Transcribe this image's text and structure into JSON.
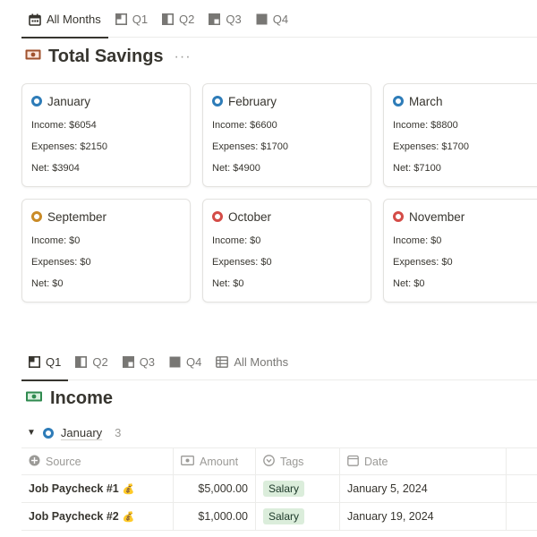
{
  "top_tabs": [
    {
      "label": "All Months",
      "icon": "calendar-icon",
      "active": true
    },
    {
      "label": "Q1",
      "icon": "quarter-icon",
      "active": false
    },
    {
      "label": "Q2",
      "icon": "half-icon",
      "active": false
    },
    {
      "label": "Q3",
      "icon": "three-quarter-icon",
      "active": false
    },
    {
      "label": "Q4",
      "icon": "full-square-icon",
      "active": false
    }
  ],
  "savings": {
    "title": "Total Savings",
    "more": "···",
    "cards": [
      {
        "month": "January",
        "dot_color": "#2e7cb8",
        "income": "Income: $6054",
        "expenses": "Expenses: $2150",
        "net": "Net: $3904"
      },
      {
        "month": "February",
        "dot_color": "#2e7cb8",
        "income": "Income: $6600",
        "expenses": "Expenses: $1700",
        "net": "Net: $4900"
      },
      {
        "month": "March",
        "dot_color": "#2e7cb8",
        "income": "Income: $8800",
        "expenses": "Expenses: $1700",
        "net": "Net: $7100"
      },
      {
        "month": "September",
        "dot_color": "#c98b27",
        "income": "Income: $0",
        "expenses": "Expenses: $0",
        "net": "Net: $0"
      },
      {
        "month": "October",
        "dot_color": "#d44c47",
        "income": "Income: $0",
        "expenses": "Expenses: $0",
        "net": "Net: $0"
      },
      {
        "month": "November",
        "dot_color": "#d44c47",
        "income": "Income: $0",
        "expenses": "Expenses: $0",
        "net": "Net: $0"
      }
    ]
  },
  "bottom_tabs": [
    {
      "label": "Q1",
      "icon": "quarter-icon",
      "active": true
    },
    {
      "label": "Q2",
      "icon": "half-icon",
      "active": false
    },
    {
      "label": "Q3",
      "icon": "three-quarter-icon",
      "active": false
    },
    {
      "label": "Q4",
      "icon": "full-square-icon",
      "active": false
    },
    {
      "label": "All Months",
      "icon": "table-icon",
      "active": false
    }
  ],
  "income": {
    "title": "Income",
    "group": {
      "label": "January",
      "count": "3",
      "dot_color": "#2e7cb8"
    },
    "columns": [
      {
        "label": "Source",
        "icon": "plus-circle-icon"
      },
      {
        "label": "Amount",
        "icon": "money-icon"
      },
      {
        "label": "Tags",
        "icon": "tags-icon"
      },
      {
        "label": "Date",
        "icon": "date-icon"
      }
    ],
    "rows": [
      {
        "source": "Job Paycheck #1",
        "emoji": "💰",
        "amount": "$5,000.00",
        "tag": "Salary",
        "date": "January 5, 2024"
      },
      {
        "source": "Job Paycheck #2",
        "emoji": "💰",
        "amount": "$1,000.00",
        "tag": "Salary",
        "date": "January 19, 2024"
      }
    ]
  },
  "colors": {
    "accent_blue": "#2e7cb8",
    "tag_green_bg": "#dbeddb",
    "savings_icon": "#a0522d",
    "income_icon": "#2f8a4f"
  }
}
